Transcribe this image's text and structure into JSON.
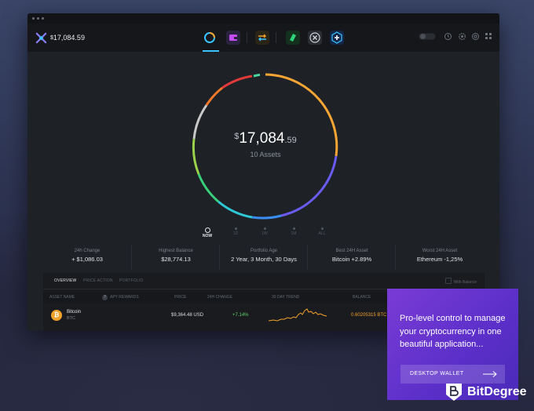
{
  "header": {
    "total_balance_symbol": "$",
    "total_balance_value": "17,084.59",
    "logo_icon": "exodus-logo-icon",
    "nav_icons": [
      "portfolio-icon",
      "wallet-icon",
      "exchange-icon",
      "app-icon",
      "x-app-icon",
      "plus-app-icon"
    ],
    "right_icons": [
      "toggle-icon",
      "history-icon",
      "settings-icon",
      "gear-icon",
      "grid-icon"
    ]
  },
  "portfolio": {
    "currency_symbol": "$",
    "value_whole": "17,084",
    "value_cents": ".59",
    "assets_count": "10 Assets"
  },
  "timeline": [
    "NOW",
    "1D",
    "1W",
    "1M",
    "ALL"
  ],
  "stats": [
    {
      "label": "24h Change",
      "value": "+ $1,086.03"
    },
    {
      "label": "Highest Balance",
      "value": "$28,774.13"
    },
    {
      "label": "Portfolio Age",
      "value": "2 Year, 3 Month, 30 Days"
    },
    {
      "label": "Best 24H Asset",
      "value": "Bitcoin +2.89%"
    },
    {
      "label": "Worst 24H Asset",
      "value": "Ethereum -1,25%"
    }
  ],
  "table": {
    "tabs": [
      "OVERVIEW",
      "PRICE ACTION",
      "PORTFOLIO"
    ],
    "with_balance": "With Balance",
    "headers": [
      "ASSET NAME",
      "APY REWARDS",
      "PRICE",
      "24H CHANGE",
      "30 DAY TREND",
      "BALANCE"
    ],
    "row": {
      "name": "Bitcoin",
      "symbol": "BTC",
      "price": "$9,364.48 USD",
      "change": "+7.14%",
      "balance": "0.60205315 BTC"
    }
  },
  "promo": {
    "text": "Pro-level control to manage your cryptocurrency in one beautiful application...",
    "button": "DESKTOP WALLET"
  },
  "brand": {
    "name": "BitDegree"
  },
  "colors": {
    "accent": "#3ac3ff",
    "promo": "#6a35d0",
    "bitcoin": "#f2a12b",
    "positive": "#5fd36a"
  }
}
